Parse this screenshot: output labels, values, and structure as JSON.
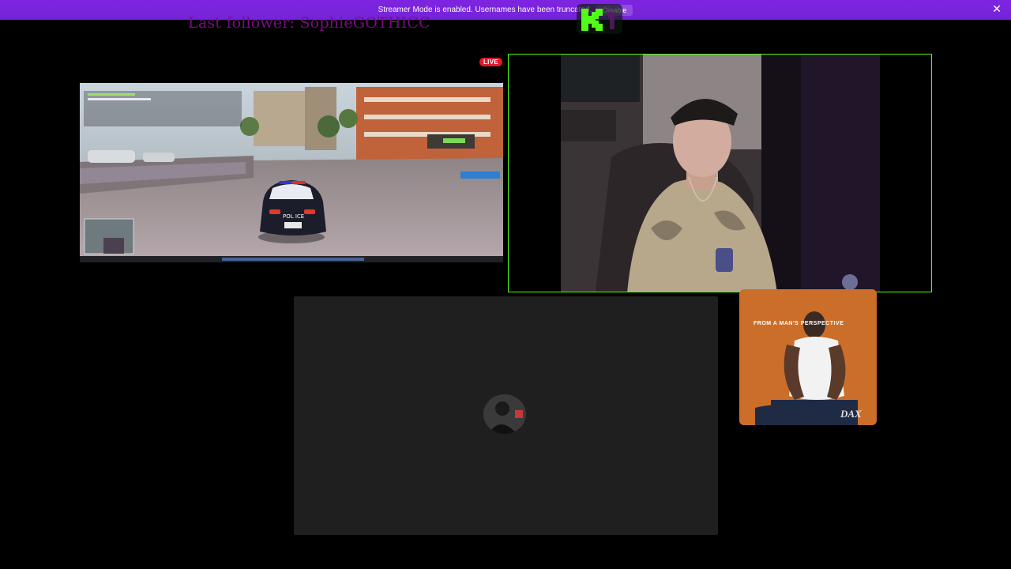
{
  "banner": {
    "message": "Streamer Mode is enabled. Usernames have been truncated.",
    "button_label": "Disable",
    "close_icon": "close-icon"
  },
  "overlay": {
    "last_follower": "Last follower: SophieGOTHICC",
    "live_badge": "LIVE",
    "logo_icon": "kick-logo-icon"
  },
  "album": {
    "top_text": "FROM A       MAN'S PERSPECTIVE",
    "artist": "DAX"
  },
  "game": {
    "hud_vehicle_label": "POL  ICE"
  },
  "colors": {
    "banner": "#7e24e0",
    "cam_border": "#53fc18",
    "follower_text": "#7a0c85",
    "live": "#e01b2c",
    "panel": "#1f1f1f"
  }
}
